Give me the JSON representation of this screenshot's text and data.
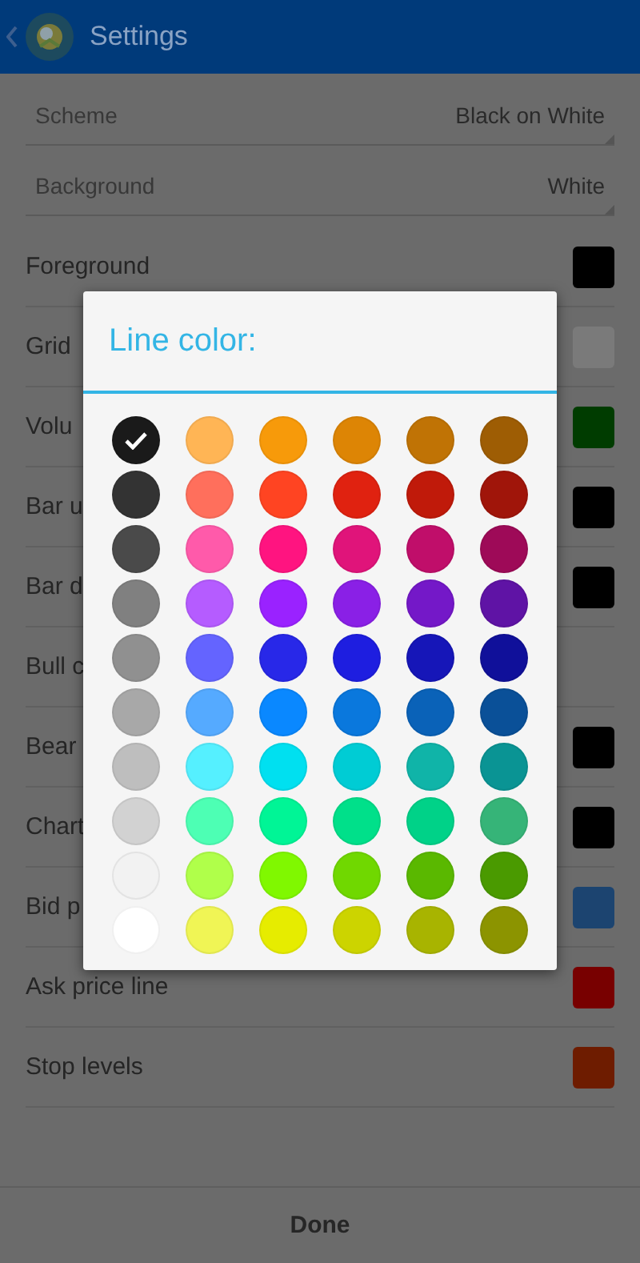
{
  "header": {
    "title": "Settings"
  },
  "spinners": [
    {
      "label": "Scheme",
      "value": "Black on White"
    },
    {
      "label": "Background",
      "value": "White"
    }
  ],
  "rows": [
    {
      "label": "Foreground",
      "color": "#000000"
    },
    {
      "label": "Grid",
      "color": "#7a7a7a"
    },
    {
      "label": "Volu",
      "color": "#003c00"
    },
    {
      "label": "Bar u",
      "color": "#000000"
    },
    {
      "label": "Bar d",
      "color": "#000000"
    },
    {
      "label": "Bull c"
    },
    {
      "label": "Bear",
      "color": "#000000"
    },
    {
      "label": "Chart",
      "color": "#000000"
    },
    {
      "label": "Bid p",
      "color": "#1c4470"
    },
    {
      "label": "Ask price line",
      "color": "#780000"
    },
    {
      "label": "Stop levels",
      "color": "#6e1c00"
    }
  ],
  "dialog": {
    "title": "Line color:",
    "swatches": [
      {
        "color": "#1a1a1a",
        "selected": true
      },
      {
        "color": "#ffb555",
        "selected": false
      },
      {
        "color": "#f79a0a",
        "selected": false
      },
      {
        "color": "#dd8505",
        "selected": false
      },
      {
        "color": "#c07305",
        "selected": false
      },
      {
        "color": "#9e5d04",
        "selected": false
      },
      {
        "color": "#333333",
        "selected": false
      },
      {
        "color": "#ff6f5c",
        "selected": false
      },
      {
        "color": "#ff4422",
        "selected": false
      },
      {
        "color": "#e02210",
        "selected": false
      },
      {
        "color": "#c01a0a",
        "selected": false
      },
      {
        "color": "#a0150a",
        "selected": false
      },
      {
        "color": "#4a4a4a",
        "selected": false
      },
      {
        "color": "#ff5aaa",
        "selected": false
      },
      {
        "color": "#ff1480",
        "selected": false
      },
      {
        "color": "#e0147a",
        "selected": false
      },
      {
        "color": "#c00e6a",
        "selected": false
      },
      {
        "color": "#9e0a58",
        "selected": false
      },
      {
        "color": "#808080",
        "selected": false
      },
      {
        "color": "#b55cff",
        "selected": false
      },
      {
        "color": "#9a22ff",
        "selected": false
      },
      {
        "color": "#8a20e6",
        "selected": false
      },
      {
        "color": "#7418c8",
        "selected": false
      },
      {
        "color": "#5f13a5",
        "selected": false
      },
      {
        "color": "#909090",
        "selected": false
      },
      {
        "color": "#6464ff",
        "selected": false
      },
      {
        "color": "#2828e8",
        "selected": false
      },
      {
        "color": "#1e1ee0",
        "selected": false
      },
      {
        "color": "#1616b8",
        "selected": false
      },
      {
        "color": "#10109a",
        "selected": false
      },
      {
        "color": "#a8a8a8",
        "selected": false
      },
      {
        "color": "#55aaff",
        "selected": false
      },
      {
        "color": "#0a88ff",
        "selected": false
      },
      {
        "color": "#0a78dd",
        "selected": false
      },
      {
        "color": "#0a62b8",
        "selected": false
      },
      {
        "color": "#0a5098",
        "selected": false
      },
      {
        "color": "#bebebe",
        "selected": false
      },
      {
        "color": "#55f0ff",
        "selected": false
      },
      {
        "color": "#00e0f0",
        "selected": false
      },
      {
        "color": "#00ccd4",
        "selected": false
      },
      {
        "color": "#10b4a8",
        "selected": false
      },
      {
        "color": "#0a9494",
        "selected": false
      },
      {
        "color": "#d2d2d2",
        "selected": false
      },
      {
        "color": "#4dffb4",
        "selected": false
      },
      {
        "color": "#00f596",
        "selected": false
      },
      {
        "color": "#00e08a",
        "selected": false
      },
      {
        "color": "#00d288",
        "selected": false
      },
      {
        "color": "#36b478",
        "selected": false
      },
      {
        "color": "#f2f2f2",
        "selected": false
      },
      {
        "color": "#b0ff4a",
        "selected": false
      },
      {
        "color": "#80f800",
        "selected": false
      },
      {
        "color": "#70d800",
        "selected": false
      },
      {
        "color": "#5ab800",
        "selected": false
      },
      {
        "color": "#4a9a00",
        "selected": false
      },
      {
        "color": "#ffffff",
        "selected": false
      },
      {
        "color": "#f0f555",
        "selected": false
      },
      {
        "color": "#e6ec00",
        "selected": false
      },
      {
        "color": "#ccd400",
        "selected": false
      },
      {
        "color": "#a8b400",
        "selected": false
      },
      {
        "color": "#8c9400",
        "selected": false
      }
    ]
  },
  "footer": {
    "button": "Done"
  }
}
